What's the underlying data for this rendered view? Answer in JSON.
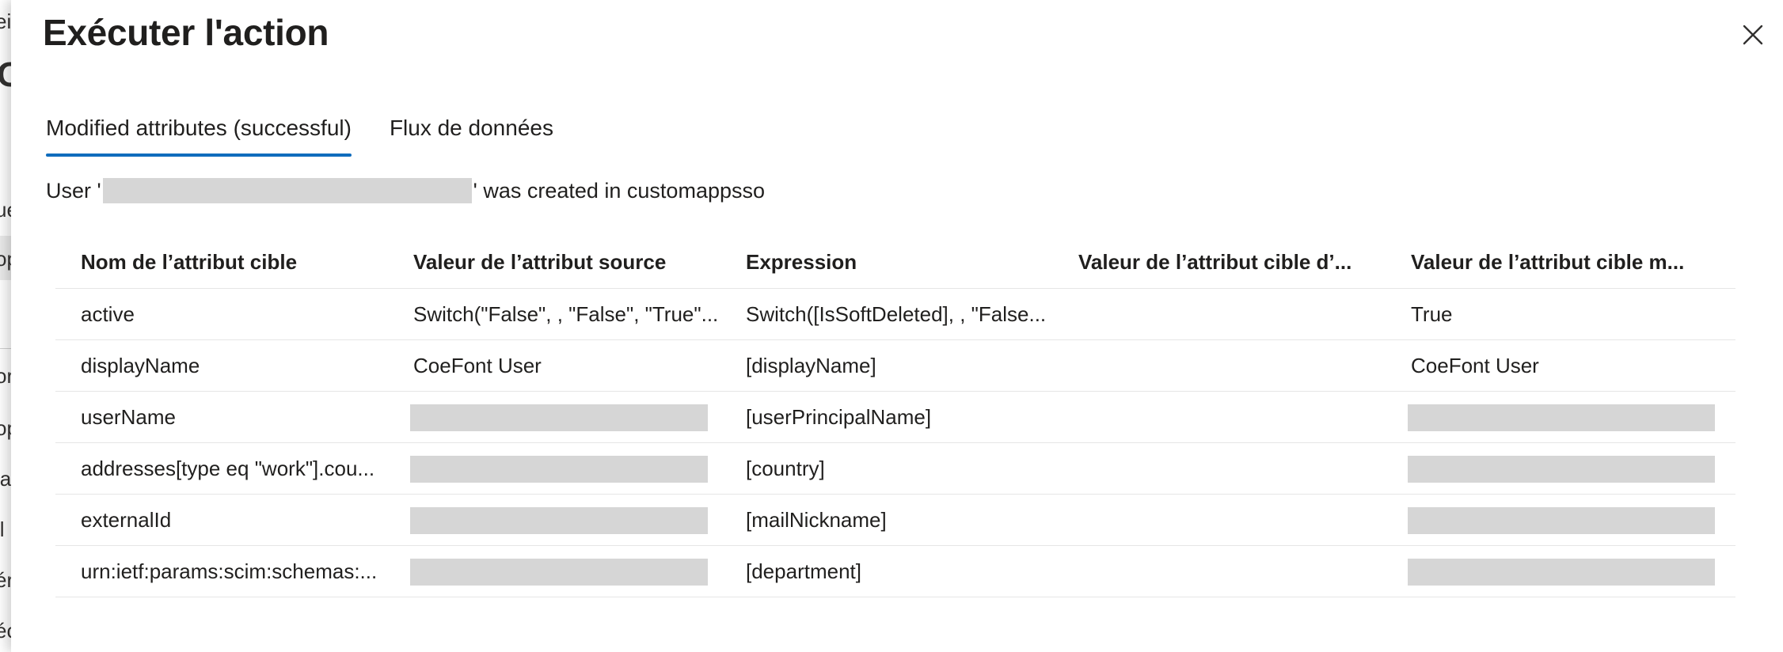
{
  "background": {
    "fragments": [
      "eil",
      "C",
      "ue",
      "op",
      "or",
      "op",
      "ia",
      "il",
      "ér",
      "éc"
    ]
  },
  "panel": {
    "title": "Exécuter l'action",
    "close_icon": "close-icon"
  },
  "tabs": [
    {
      "label": "Modified attributes (successful)",
      "selected": true
    },
    {
      "label": "Flux de données",
      "selected": false
    }
  ],
  "message": {
    "prefix": "User '",
    "suffix": "' was created in customappsso"
  },
  "table": {
    "columns": [
      "Nom de l’attribut cible",
      "Valeur de l’attribut source",
      "Expression",
      "Valeur de l’attribut cible d’...",
      "Valeur de l’attribut cible m..."
    ],
    "rows": [
      {
        "target_attribute": "active",
        "source_value": "Switch(\"False\", , \"False\", \"True\"...",
        "expression": "Switch([IsSoftDeleted], , \"False...",
        "target_before": "",
        "target_after": "True"
      },
      {
        "target_attribute": "displayName",
        "source_value": "CoeFont User",
        "expression": "[displayName]",
        "target_before": "",
        "target_after": "CoeFont User"
      },
      {
        "target_attribute": "userName",
        "source_value": "",
        "expression": "[userPrincipalName]",
        "target_before": "",
        "target_after": ""
      },
      {
        "target_attribute": "addresses[type eq \"work\"].cou...",
        "source_value": "",
        "expression": "[country]",
        "target_before": "",
        "target_after": ""
      },
      {
        "target_attribute": "externalId",
        "source_value": "",
        "expression": "[mailNickname]",
        "target_before": "",
        "target_after": ""
      },
      {
        "target_attribute": "urn:ietf:params:scim:schemas:...",
        "source_value": "",
        "expression": "[department]",
        "target_before": "",
        "target_after": ""
      }
    ]
  },
  "colors": {
    "accent": "#0f6cbd",
    "redaction": "#d6d6d6",
    "divider": "#e6e6e6",
    "text": "#201f1e"
  }
}
